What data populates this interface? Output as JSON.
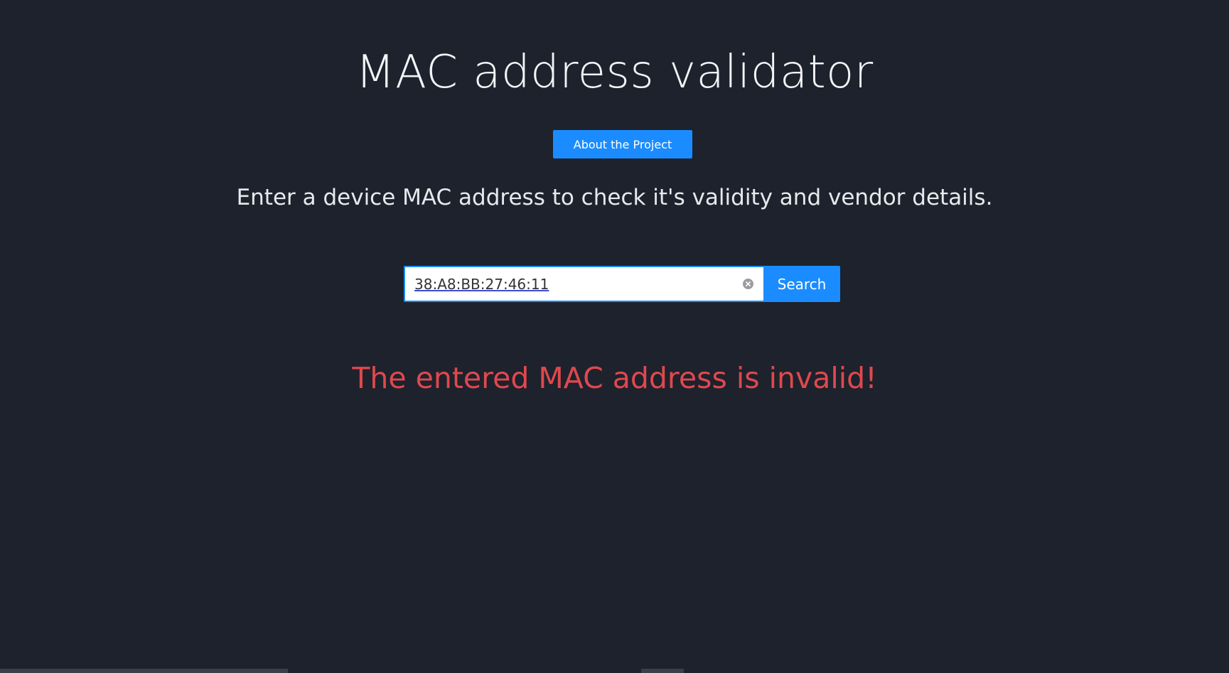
{
  "page": {
    "title": "MAC address validator",
    "subtitle": "Enter a device MAC address to check it's validity and vendor details."
  },
  "about_button": {
    "label": "About the Project"
  },
  "search": {
    "value": "38:A8:BB:27:46:11",
    "button_label": "Search",
    "clear_icon": "close-circle-icon"
  },
  "result": {
    "message": "The entered MAC address is invalid!"
  },
  "colors": {
    "background": "#1d222d",
    "accent": "#1a8cff",
    "error": "#e0484d"
  }
}
